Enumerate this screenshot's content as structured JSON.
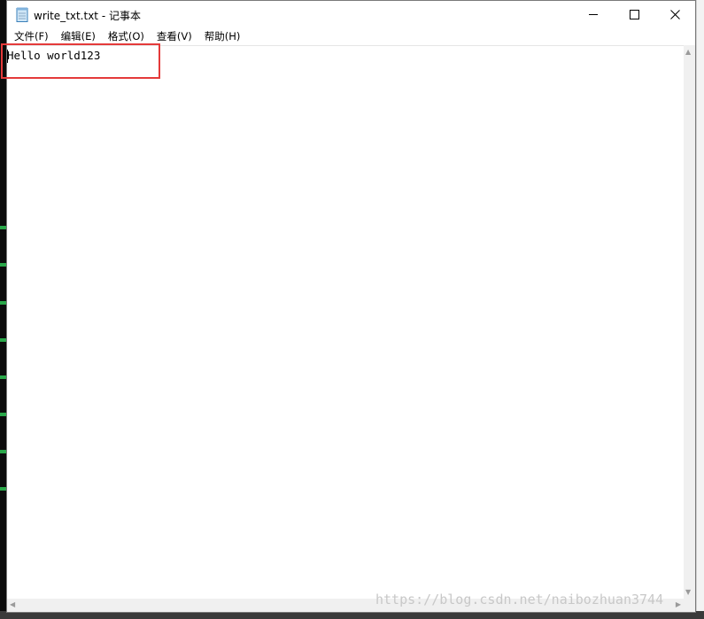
{
  "window": {
    "title": "write_txt.txt - 记事本",
    "minimize_label": "─",
    "maximize_label": "☐",
    "close_label": "✕"
  },
  "menu": {
    "items": [
      "文件(F)",
      "编辑(E)",
      "格式(O)",
      "查看(V)",
      "帮助(H)"
    ]
  },
  "editor": {
    "content": "Hello world123"
  },
  "scrollbars": {
    "up": "▲",
    "down": "▼",
    "left": "◀",
    "right": "▶"
  },
  "watermark": "https://blog.csdn.net/naibozhuan3744",
  "colors": {
    "highlight": "#e43a3a"
  },
  "icons": {
    "app": "notepad-icon"
  }
}
